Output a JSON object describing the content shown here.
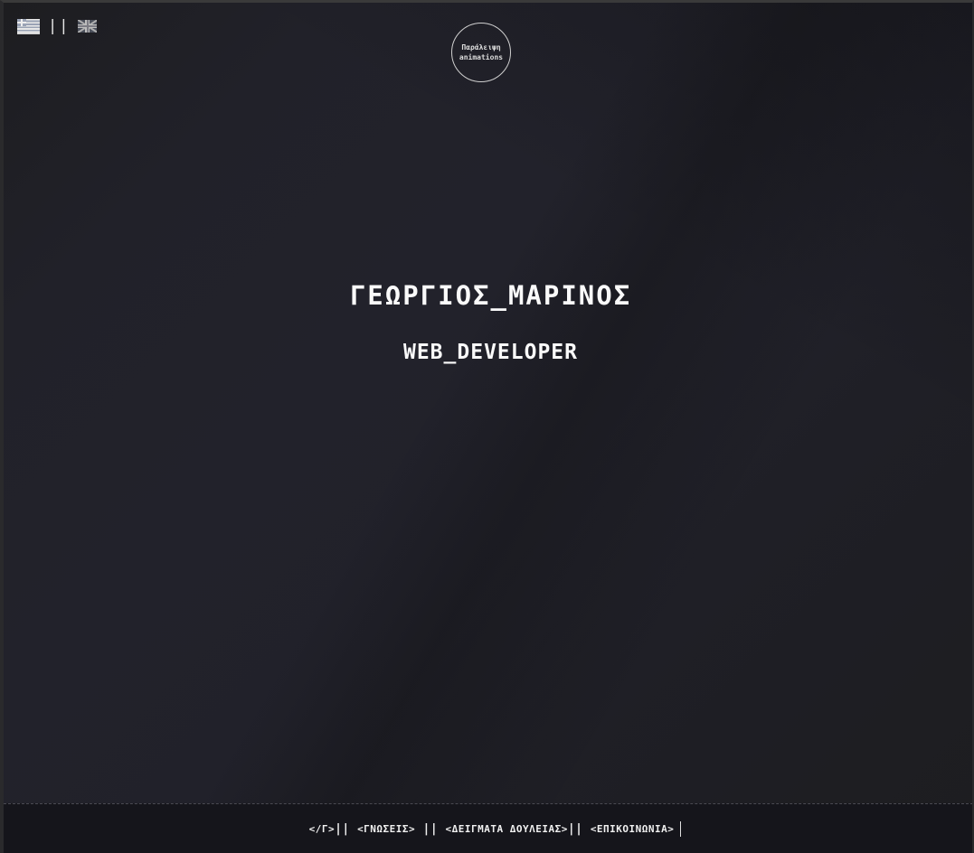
{
  "language_switch": {
    "greek_flag_icon": "greek-flag-icon",
    "separator": "||",
    "uk_flag_icon": "uk-flag-icon"
  },
  "skip_animations": {
    "line1": "Παράλειψη",
    "line2": "animations"
  },
  "hero": {
    "name": "ΓΕΩΡΓΙΟΣ_ΜΑΡΙΝΟΣ",
    "role": "WEB_DEVELOPER"
  },
  "nav": {
    "home": "</Γ>",
    "sep1": "|| ",
    "knowledge": "<ΓΝΩΣΕΙΣ>",
    "sep2": " || ",
    "work_samples": "<ΔΕΙΓΜΑΤΑ ΔΟΥΛΕΙΑΣ>",
    "sep3": "|| ",
    "contact": "<ΕΠΙΚΟΙΝΩΝΙΑ>"
  },
  "colors": {
    "background": "#1e1e24",
    "text": "#f2f2f2",
    "nav_background": "#15151b"
  }
}
